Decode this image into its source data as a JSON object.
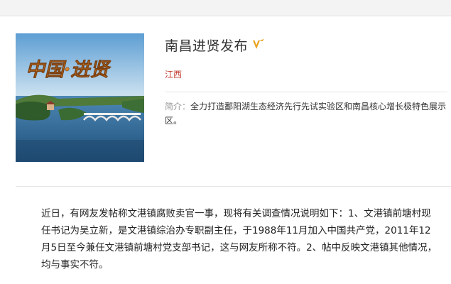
{
  "profile": {
    "avatar_caption": "中国·进贤",
    "name": "南昌进贤发布",
    "verified_badge": "V",
    "location": "江西",
    "intro_label": "简介：",
    "intro_text": "全力打造鄱阳湖生态经济先行先试实验区和南昌核心增长极特色展示区。"
  },
  "article": {
    "body": "近日，有网友发帖称文港镇腐败卖官一事，现将有关调查情况说明如下：1、文港镇前塘村现任书记为吴立新，是文港镇综治办专职副主任，于1988年11月加入中国共产党，2011年12月5日至今兼任文港镇前塘村党支部书记，这与网友所称不符。2、帖中反映文港镇其他情况，均与事实不符。"
  },
  "colors": {
    "location": "#c0392b",
    "verified": "#e8a21e",
    "caption": "#e0872a"
  }
}
